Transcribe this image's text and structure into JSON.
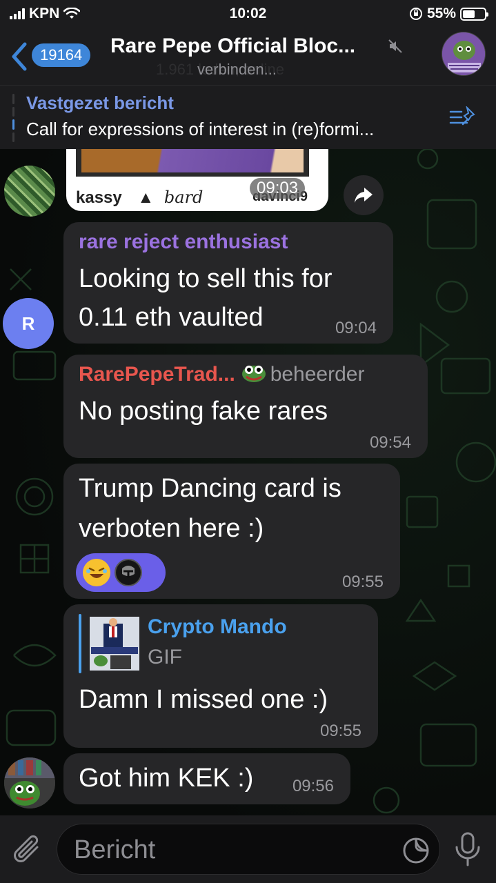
{
  "status_bar": {
    "carrier": "KPN",
    "time": "10:02",
    "battery": "55%",
    "battery_level": 0.55
  },
  "header": {
    "back_count": "19164",
    "title": "Rare Pepe Official Bloc...",
    "subtitle_ghost": "1.961 leden, online",
    "subtitle": "verbinden..."
  },
  "pinned": {
    "title": "Vastgezet bericht",
    "text": "Call for expressions of interest in (re)formi..."
  },
  "messages": [
    {
      "type": "image",
      "caption_left": "kassy",
      "caption_mid": "bard",
      "caption_right": "davinci9",
      "time": "09:03"
    },
    {
      "sender": "rare reject enthusiast",
      "sender_color": "#9b72e0",
      "avatar_letter": "R",
      "text_line1": "Looking to sell this for",
      "text_line2": "0.11 eth vaulted",
      "time": "09:04"
    },
    {
      "sender": "RarePepeTrad...",
      "sender_color": "#e8564e",
      "admin_label": "beheerder",
      "text": "No posting fake rares",
      "time": "09:54"
    },
    {
      "text_line1": "Trump Dancing card is",
      "text_line2": "verboten here :)",
      "time": "09:55",
      "reactions": [
        "laughing-emoji",
        "mando-avatar"
      ]
    },
    {
      "reply_name": "Crypto Mando",
      "reply_type": "GIF",
      "text": "Damn I missed one :)",
      "time": "09:55"
    },
    {
      "text": "Got him KEK :)",
      "time": "09:56"
    }
  ],
  "input": {
    "placeholder": "Bericht"
  },
  "colors": {
    "accent": "#3e86d9",
    "pinned_title": "#7a98e6",
    "reply_name": "#4aa1ee",
    "reaction_bg": "#6a5fe8"
  }
}
